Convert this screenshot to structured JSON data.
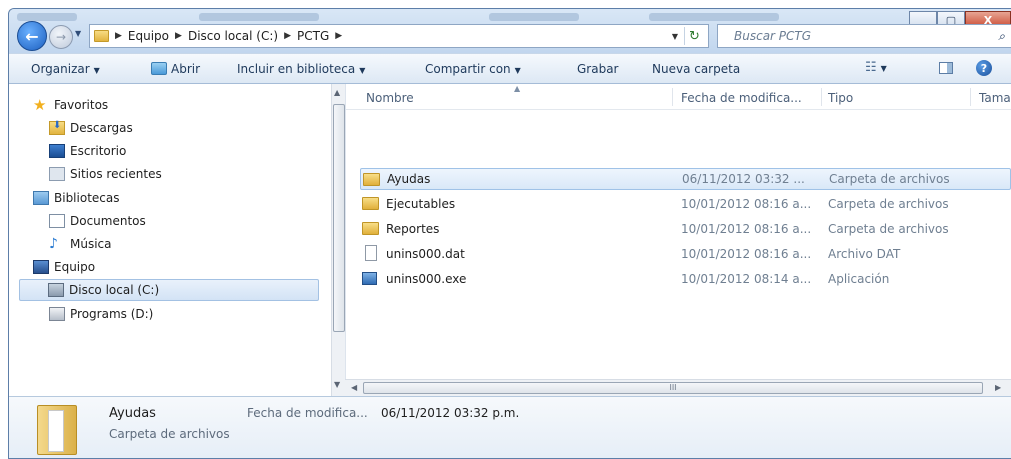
{
  "address": {
    "crumbs": [
      "Equipo",
      "Disco local (C:)",
      "PCTG"
    ],
    "search_placeholder": "Buscar PCTG"
  },
  "toolbar": {
    "organize": "Organizar",
    "open": "Abrir",
    "include_library": "Incluir en biblioteca",
    "share_with": "Compartir con",
    "burn": "Grabar",
    "new_folder": "Nueva carpeta"
  },
  "nav": {
    "favorites": "Favoritos",
    "downloads": "Descargas",
    "desktop": "Escritorio",
    "recent": "Sitios recientes",
    "libraries": "Bibliotecas",
    "documents": "Documentos",
    "music": "Música",
    "computer": "Equipo",
    "local_disk": "Disco local (C:)",
    "programs": "Programs (D:)"
  },
  "columns": {
    "name": "Nombre",
    "date": "Fecha de modifica...",
    "type": "Tipo",
    "size": "Tamañ"
  },
  "files": [
    {
      "name": "Ayudas",
      "date": "06/11/2012 03:32 ...",
      "type": "Carpeta de archivos",
      "size": ""
    },
    {
      "name": "Ejecutables",
      "date": "10/01/2012 08:16 a...",
      "type": "Carpeta de archivos",
      "size": ""
    },
    {
      "name": "Reportes",
      "date": "10/01/2012 08:16 a...",
      "type": "Carpeta de archivos",
      "size": ""
    },
    {
      "name": "unins000.dat",
      "date": "10/01/2012 08:16 a...",
      "type": "Archivo DAT",
      "size": ""
    },
    {
      "name": "unins000.exe",
      "date": "10/01/2012 08:14 a...",
      "type": "Aplicación",
      "size": "("
    }
  ],
  "details": {
    "name": "Ayudas",
    "type": "Carpeta de archivos",
    "date_label": "Fecha de modifica...",
    "date_value": "06/11/2012 03:32 p.m."
  },
  "scroll": {
    "hscroll_grip": "III"
  }
}
